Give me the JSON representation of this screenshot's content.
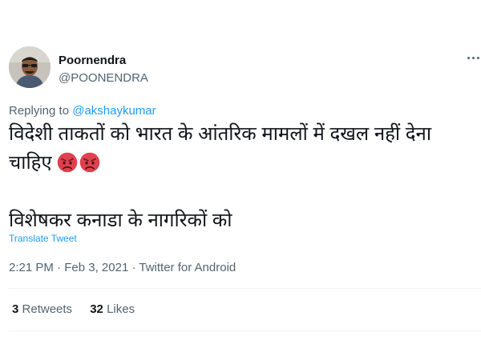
{
  "author": {
    "display_name": "Poornendra",
    "handle": "@POONENDRA"
  },
  "reply": {
    "prefix": "Replying to",
    "target": "@akshaykumar"
  },
  "tweet": {
    "line1": "विदेशी ताकतों को भारत के आंतरिक मामलों में दखल नहीं देना",
    "line2": "चाहिए",
    "line3": "विशेषकर कनाडा के नागरिकों को",
    "emoji": [
      "angry-face-emoji",
      "angry-face-emoji"
    ]
  },
  "translate_label": "Translate Tweet",
  "meta": {
    "time": "2:21 PM",
    "date": "Feb 3, 2021",
    "source": "Twitter for Android"
  },
  "stats": {
    "retweets_count": "3",
    "retweets_label": "Retweets",
    "likes_count": "32",
    "likes_label": "Likes"
  },
  "icons": {
    "more": "more-horizontal-icon"
  },
  "colors": {
    "link": "#1d9bf0",
    "secondary_text": "#536471",
    "primary_text": "#0f1419"
  }
}
